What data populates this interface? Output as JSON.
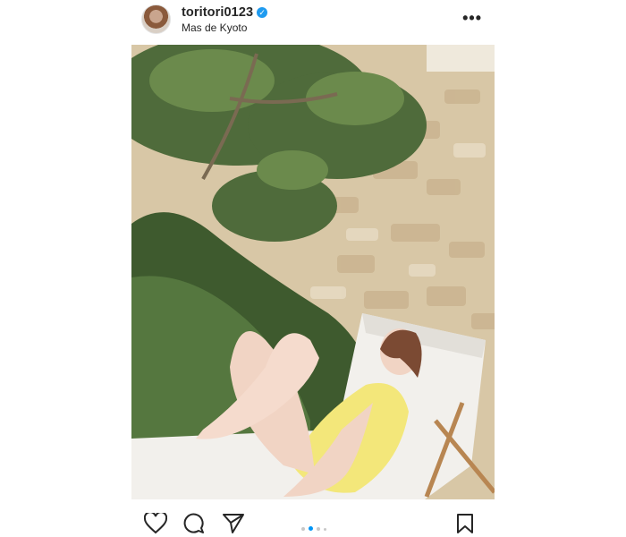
{
  "header": {
    "username": "toritori0123",
    "verified_symbol": "✓",
    "location": "Mas de Kyoto",
    "more_label": "•••"
  },
  "photo": {
    "description_colors": {
      "wall": "#d8c7a6",
      "foliage": "#4f6b3b",
      "lounger": "#f2f0ec",
      "swimsuit": "#f3e77a",
      "skin": "#f1d4c4"
    }
  },
  "actions": {
    "icons": [
      "heart-icon",
      "comment-icon",
      "share-icon",
      "bookmark-icon"
    ],
    "carousel": {
      "count": 4,
      "active_index": 1
    }
  },
  "colors": {
    "accent": "#0095f6",
    "verified": "#1f9bf0",
    "text": "#262626"
  }
}
